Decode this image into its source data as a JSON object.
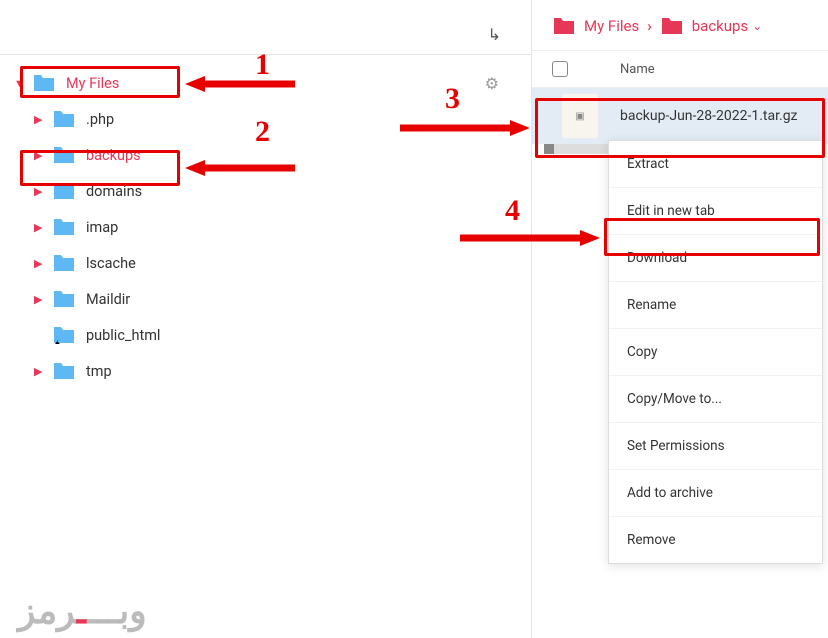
{
  "sidebar": {
    "root": {
      "label": "My Files",
      "expanded": true,
      "highlighted": true
    },
    "children": [
      {
        "label": ".php",
        "highlighted": false
      },
      {
        "label": "backups",
        "highlighted": true
      },
      {
        "label": "domains",
        "highlighted": false
      },
      {
        "label": "imap",
        "highlighted": false
      },
      {
        "label": "lscache",
        "highlighted": false
      },
      {
        "label": "Maildir",
        "highlighted": false
      },
      {
        "label": "public_html",
        "highlighted": false,
        "is_link": true
      },
      {
        "label": "tmp",
        "highlighted": false
      }
    ]
  },
  "breadcrumb": {
    "root": "My Files",
    "current": "backups"
  },
  "list_header": {
    "name": "Name"
  },
  "selected_file": {
    "name": "backup-Jun-28-2022-1.tar.gz"
  },
  "context_menu": [
    "Extract",
    "Edit in new tab",
    "Download",
    "Rename",
    "Copy",
    "Copy/Move to...",
    "Set Permissions",
    "Add to archive",
    "Remove"
  ],
  "annotations": {
    "steps": {
      "1": "1",
      "2": "2",
      "3": "3",
      "4": "4"
    }
  },
  "colors": {
    "accent": "#e63757",
    "annotation": "#e60000",
    "folder": "#5eb8f3",
    "folder_accent": "#e63757"
  },
  "logo": "وبـــــرمز"
}
